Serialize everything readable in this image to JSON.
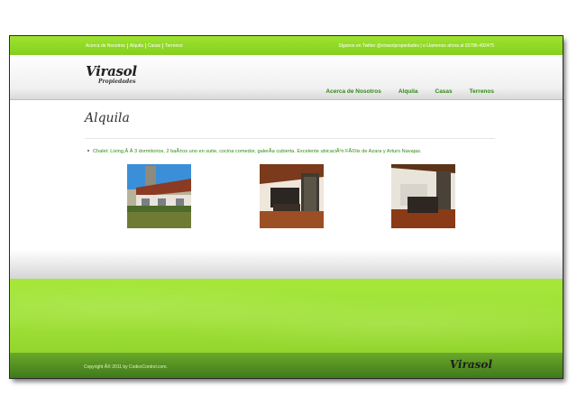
{
  "topbar": {
    "nav": [
      "Acerca de Nosotros",
      "Alquila",
      "Casas",
      "Terrenos"
    ],
    "follow_text": "Siganos en Twitter @virasolpropiedades | o Llamenos ahora al 03786-492475"
  },
  "header": {
    "logo_main": "Virasol",
    "logo_sub": "Propiedades",
    "nav": [
      "Acerca de Nosotros",
      "Alquila",
      "Casas",
      "Terrenos"
    ]
  },
  "main": {
    "title": "Alquila",
    "listing": "Chalet: Living,Â Â 3 dormitorios, 2 baÃ±os uno en suite, cocina comedor, galerÃ­a cubierta. Excelente ubicaciÃ³n FÃ©lix de Azara y Arturo Navajas.",
    "photos": [
      "house-exterior-photo",
      "dining-room-photo",
      "living-room-photo"
    ]
  },
  "footer": {
    "copyright": "Copyright Â© 2011 by CodexControl.com.",
    "logo": "Virasol"
  },
  "colors": {
    "brand_green": "#86cf1f",
    "link_green": "#2e8b14",
    "footer_dark": "#3f7a1a"
  }
}
